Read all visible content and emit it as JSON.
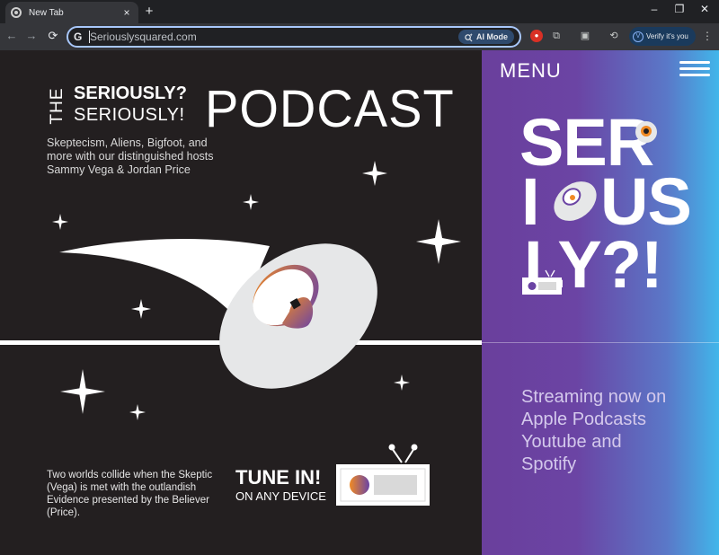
{
  "browser": {
    "tab_title": "New Tab",
    "tab_close": "×",
    "new_tab": "+",
    "window_controls": {
      "minimize": "–",
      "restore": "❐",
      "close": "✕"
    },
    "nav": {
      "back": "←",
      "forward": "→",
      "reload": "⟳"
    },
    "omnibox": {
      "google_glyph": "G",
      "url": "Seriouslysquared.com"
    },
    "ai_mode": {
      "label": "AI Mode",
      "icon": "sparkle-search-icon"
    },
    "extensions": [
      "shield-extension-icon",
      "puzzle-extension-icon",
      "tab-search-icon",
      "sync-icon"
    ],
    "profile": {
      "initial": "V",
      "label": "Verify it's you"
    },
    "menu": "⋮",
    "colors": {
      "frame": "#202124",
      "toolbar": "#35363a",
      "omnibox_border": "#a8c7fa"
    }
  },
  "page": {
    "logo": {
      "the": "THE",
      "line1": "SERIOUSLY?",
      "line2": "SERIOUSLY!",
      "podcast": "PODCAST"
    },
    "tagline": "Skeptecism, Aliens, Bigfoot, and more with our distinguished hosts Sammy Vega & Jordan Price",
    "story": "Two worlds collide when the Skeptic (Vega) is met with the outlandish Evidence presented by the Believer (Price).",
    "tune_in": "TUNE IN!",
    "any_device": "ON ANY DEVICE",
    "menu_label": "MENU",
    "brand": {
      "row1": "SER",
      "row2_a": "I",
      "row2_b": "US",
      "row3": "LY?!"
    },
    "streaming_lines": [
      "Streaming now on",
      "Apple Podcasts",
      "Youtube and",
      "Spotify"
    ],
    "colors": {
      "background": "#231f20",
      "panel_start": "#6a3f9c",
      "panel_end": "#41b6ea",
      "ufo": "#e6e7e8",
      "accent_orange": "#f08a24",
      "accent_purple": "#6b44a4"
    }
  }
}
